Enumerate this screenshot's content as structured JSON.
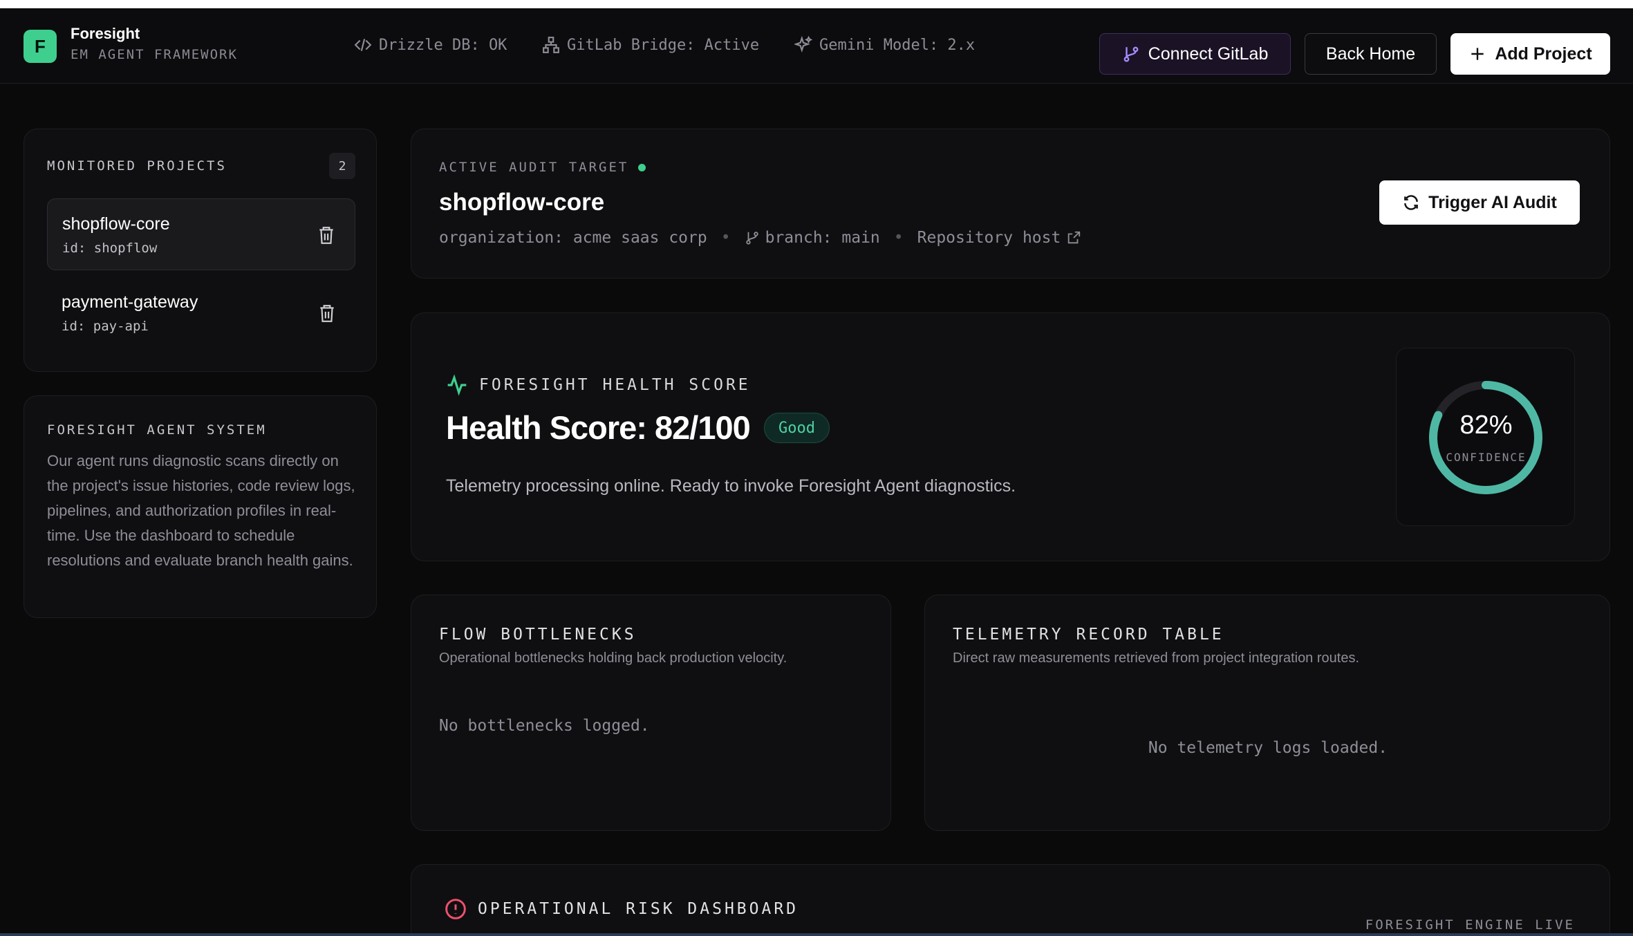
{
  "header": {
    "logo_letter": "F",
    "brand_title": "Foresight",
    "brand_subtitle": "EM AGENT FRAMEWORK",
    "status": {
      "db": "Drizzle DB: OK",
      "gitlab": "GitLab Bridge: Active",
      "gemini": "Gemini Model: 2.x"
    },
    "connect_gitlab_label": "Connect GitLab",
    "back_home_label": "Back Home",
    "add_project_label": "Add Project"
  },
  "sidebar": {
    "projects_title": "MONITORED PROJECTS",
    "projects_count": "2",
    "projects": [
      {
        "name": "shopflow-core",
        "id": "id: shopflow",
        "active": true
      },
      {
        "name": "payment-gateway",
        "id": "id: pay-api",
        "active": false
      }
    ],
    "agent_title": "FORESIGHT AGENT SYSTEM",
    "agent_description": "Our agent runs diagnostic scans directly on the project's issue histories, code review logs, pipelines, and authorization profiles in real-time. Use the dashboard to schedule resolutions and evaluate branch health gains."
  },
  "audit": {
    "label": "ACTIVE AUDIT TARGET",
    "title": "shopflow-core",
    "organization": "organization: acme saas corp",
    "branch": "branch: main",
    "repo_host": "Repository host",
    "trigger_label": "Trigger AI Audit"
  },
  "health": {
    "label": "FORESIGHT HEALTH SCORE",
    "score_text": "Health Score: 82/100",
    "badge": "Good",
    "description": "Telemetry processing online. Ready to invoke Foresight Agent diagnostics.",
    "confidence_pct": "82%",
    "confidence_value": 82,
    "confidence_label": "CONFIDENCE",
    "accent_color": "#4fb8a4"
  },
  "bottlenecks": {
    "title": "FLOW BOTTLENECKS",
    "subtitle": "Operational bottlenecks holding back production velocity.",
    "empty": "No bottlenecks logged."
  },
  "telemetry": {
    "title": "TELEMETRY RECORD TABLE",
    "subtitle": "Direct raw measurements retrieved from project integration routes.",
    "empty": "No telemetry logs loaded."
  },
  "risk": {
    "title": "OPERATIONAL RISK DASHBOARD",
    "engine_status": "FORESIGHT ENGINE LIVE"
  }
}
